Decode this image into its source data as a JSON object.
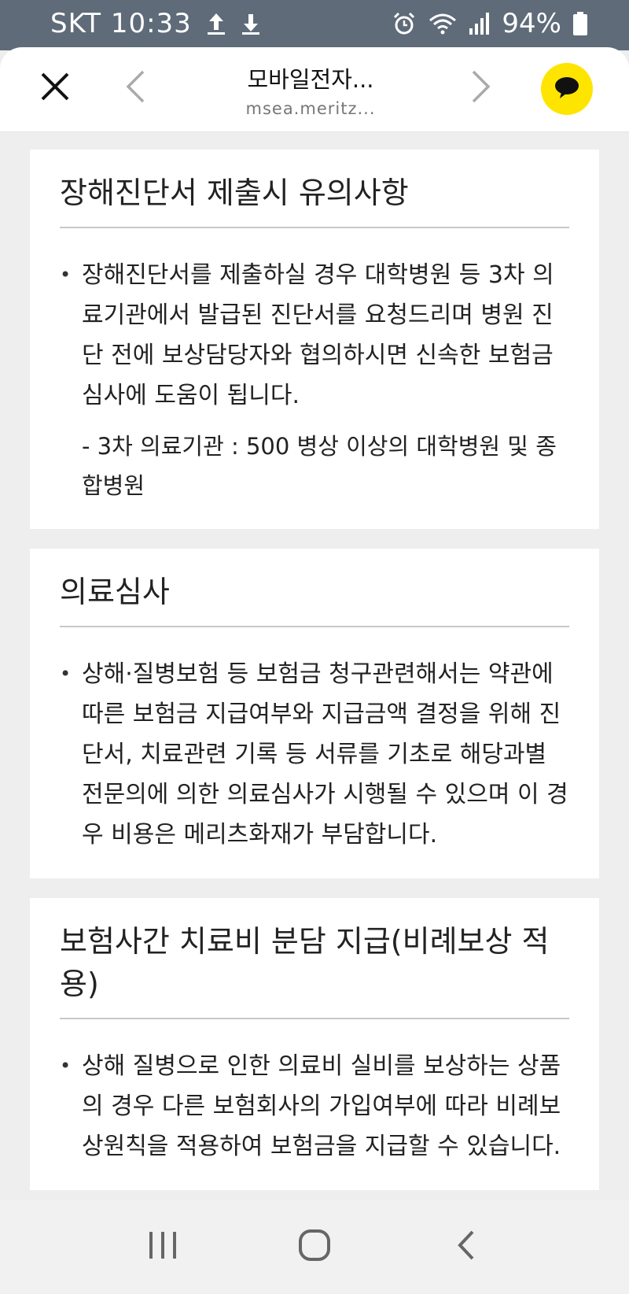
{
  "status_bar": {
    "carrier_time": "SKT 10:33",
    "battery": "94%"
  },
  "header": {
    "title": "모바일전자...",
    "subtitle": "msea.meritz..."
  },
  "cards": [
    {
      "title": "장해진단서 제출시 유의사항",
      "bullet": "장해진단서를 제출하실 경우 대학병원 등 3차 의료기관에서 발급된 진단서를 요청드리며 병원 진단 전에 보상담당자와 협의하시면 신속한 보험금 심사에 도움이 됩니다.",
      "note": "- 3차 의료기관 : 500 병상 이상의 대학병원 및 종합병원"
    },
    {
      "title": "의료심사",
      "bullet": "상해·질병보험 등 보험금 청구관련해서는 약관에 따른 보험금 지급여부와 지급금액 결정을 위해 진단서, 치료관련 기록 등 서류를 기초로 해당과별 전문의에 의한 의료심사가 시행될 수 있으며 이 경우 비용은 메리츠화재가 부담합니다."
    },
    {
      "title": "보험사간 치료비 분담 지급(비례보상 적용)",
      "bullet": "상해 질병으로 인한 의료비 실비를 보상하는 상품의 경우 다른 보험회사의 가입여부에 따라 비례보상원칙을 적용하여 보험금을 지급할 수 있습니다."
    }
  ],
  "icons": {
    "upload": "upload-icon",
    "download": "download-icon",
    "alarm": "alarm-icon",
    "wifi": "wifi-icon",
    "signal": "signal-icon",
    "battery": "battery-icon",
    "close": "close-icon",
    "prev": "chevron-left-icon",
    "next": "chevron-right-icon",
    "kakao": "kakaotalk-icon",
    "recent": "recent-apps-icon",
    "home": "home-icon",
    "back": "back-icon"
  },
  "colors": {
    "status_bar": "#5f6b78",
    "kakao_yellow": "#fee500",
    "page_bg": "#eeeeee"
  }
}
